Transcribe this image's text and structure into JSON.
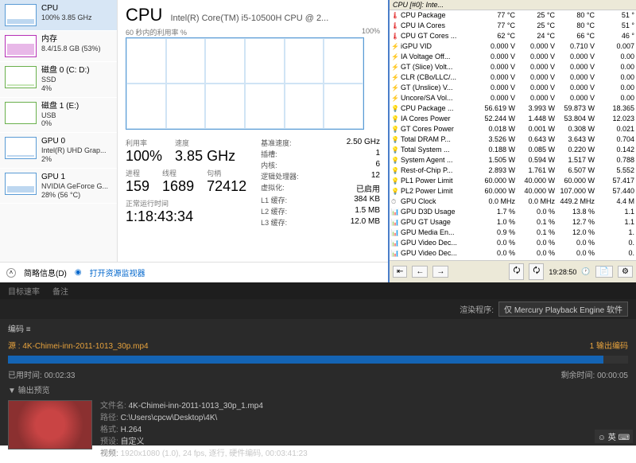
{
  "tm": {
    "sidebar": [
      {
        "title": "CPU",
        "sub": "100%  3.85 GHz"
      },
      {
        "title": "内存",
        "sub": "8.4/15.8 GB (53%)"
      },
      {
        "title": "磁盘 0 (C: D:)",
        "sub": "SSD\n4%"
      },
      {
        "title": "磁盘 1 (E:)",
        "sub": "USB\n0%"
      },
      {
        "title": "GPU 0",
        "sub": "Intel(R) UHD Grap...\n2%"
      },
      {
        "title": "GPU 1",
        "sub": "NVIDIA GeForce G...\n28% (56 °C)"
      }
    ],
    "title": "CPU",
    "subtitle": "Intel(R) Core(TM) i5-10500H CPU @ 2...",
    "graph_label_left": "60 秒内的利用率 %",
    "graph_label_right": "100%",
    "stats_left": {
      "util_lab": "利用率",
      "util": "100%",
      "spd_lab": "速度",
      "spd": "3.85 GHz",
      "proc_lab": "进程",
      "proc": "159",
      "thr_lab": "线程",
      "thr": "1689",
      "hnd_lab": "句柄",
      "hnd": "72412",
      "up_lab": "正常运行时间",
      "up": "1:18:43:34"
    },
    "stats_right": [
      {
        "k": "基准速度:",
        "v": "2.50 GHz"
      },
      {
        "k": "插槽:",
        "v": "1"
      },
      {
        "k": "内核:",
        "v": "6"
      },
      {
        "k": "逻辑处理器:",
        "v": "12"
      },
      {
        "k": "虚拟化:",
        "v": "已启用"
      },
      {
        "k": "L1 缓存:",
        "v": "384 KB"
      },
      {
        "k": "L2 缓存:",
        "v": "1.5 MB"
      },
      {
        "k": "L3 缓存:",
        "v": "12.0 MB"
      }
    ],
    "foot_brief": "简略信息(D)",
    "foot_link": "打开资源监视器"
  },
  "hw": {
    "header": "CPU [#0]: Inte...",
    "rows": [
      {
        "ic": "t",
        "n": "CPU Package",
        "a": "77 °C",
        "b": "25 °C",
        "c": "80 °C",
        "d": "51 °"
      },
      {
        "ic": "t",
        "n": "CPU IA Cores",
        "a": "77 °C",
        "b": "25 °C",
        "c": "80 °C",
        "d": "51 °"
      },
      {
        "ic": "t",
        "n": "CPU GT Cores ...",
        "a": "62 °C",
        "b": "24 °C",
        "c": "66 °C",
        "d": "46 °"
      },
      {
        "ic": "v",
        "n": "iGPU VID",
        "a": "0.000 V",
        "b": "0.000 V",
        "c": "0.710 V",
        "d": "0.007"
      },
      {
        "ic": "v",
        "n": "IA Voltage Off...",
        "a": "0.000 V",
        "b": "0.000 V",
        "c": "0.000 V",
        "d": "0.00"
      },
      {
        "ic": "v",
        "n": "GT (Slice) Volt...",
        "a": "0.000 V",
        "b": "0.000 V",
        "c": "0.000 V",
        "d": "0.00"
      },
      {
        "ic": "v",
        "n": "CLR (CBo/LLC/...",
        "a": "0.000 V",
        "b": "0.000 V",
        "c": "0.000 V",
        "d": "0.00"
      },
      {
        "ic": "v",
        "n": "GT (Unslice) V...",
        "a": "0.000 V",
        "b": "0.000 V",
        "c": "0.000 V",
        "d": "0.00"
      },
      {
        "ic": "v",
        "n": "Uncore/SA Vol...",
        "a": "0.000 V",
        "b": "0.000 V",
        "c": "0.000 V",
        "d": "0.00"
      },
      {
        "ic": "w",
        "n": "CPU Package ...",
        "a": "56.619 W",
        "b": "3.993 W",
        "c": "59.873 W",
        "d": "18.365"
      },
      {
        "ic": "w",
        "n": "IA Cores Power",
        "a": "52.244 W",
        "b": "1.448 W",
        "c": "53.804 W",
        "d": "12.023"
      },
      {
        "ic": "w",
        "n": "GT Cores Power",
        "a": "0.018 W",
        "b": "0.001 W",
        "c": "0.308 W",
        "d": "0.021"
      },
      {
        "ic": "w",
        "n": "Total DRAM P...",
        "a": "3.526 W",
        "b": "0.643 W",
        "c": "3.643 W",
        "d": "0.704"
      },
      {
        "ic": "w",
        "n": "Total System ...",
        "a": "0.188 W",
        "b": "0.085 W",
        "c": "0.220 W",
        "d": "0.142"
      },
      {
        "ic": "w",
        "n": "System Agent ...",
        "a": "1.505 W",
        "b": "0.594 W",
        "c": "1.517 W",
        "d": "0.788"
      },
      {
        "ic": "w",
        "n": "Rest-of-Chip P...",
        "a": "2.893 W",
        "b": "1.761 W",
        "c": "6.507 W",
        "d": "5.552"
      },
      {
        "ic": "w",
        "n": "PL1 Power Limit",
        "a": "60.000 W",
        "b": "40.000 W",
        "c": "60.000 W",
        "d": "57.417"
      },
      {
        "ic": "w",
        "n": "PL2 Power Limit",
        "a": "60.000 W",
        "b": "40.000 W",
        "c": "107.000 W",
        "d": "57.440"
      },
      {
        "ic": "c",
        "n": "GPU Clock",
        "a": "0.0 MHz",
        "b": "0.0 MHz",
        "c": "449.2 MHz",
        "d": "4.4 M"
      },
      {
        "ic": "u",
        "n": "GPU D3D Usage",
        "a": "1.7 %",
        "b": "0.0 %",
        "c": "13.8 %",
        "d": "1.1"
      },
      {
        "ic": "u",
        "n": "GPU GT Usage",
        "a": "1.0 %",
        "b": "0.1 %",
        "c": "12.7 %",
        "d": "1.1"
      },
      {
        "ic": "u",
        "n": "GPU Media En...",
        "a": "0.9 %",
        "b": "0.1 %",
        "c": "12.0 %",
        "d": "1."
      },
      {
        "ic": "u",
        "n": "GPU Video Dec...",
        "a": "0.0 %",
        "b": "0.0 %",
        "c": "0.0 %",
        "d": "0."
      },
      {
        "ic": "u",
        "n": "GPU Video Dec...",
        "a": "0.0 %",
        "b": "0.0 %",
        "c": "0.0 %",
        "d": "0."
      }
    ],
    "time": "19:28:50"
  },
  "ame": {
    "tabs": [
      "目标速率",
      "备注"
    ],
    "render_lab": "渲染程序:",
    "render_val": "仅 Mercury Playback Engine 软件",
    "encode": "编码 ≡",
    "src_lab": "源",
    "src_val": "4K-Chimei-inn-2011-1013_30p.mp4",
    "out_count": "1 输出编码",
    "elapsed_lab": "已用时间:",
    "elapsed": "00:02:33",
    "remain_lab": "剩余时间:",
    "remain": "00:00:05",
    "preview": "▼ 输出预览",
    "meta": {
      "file_k": "文件名:",
      "file_v": "4K-Chimei-inn-2011-1013_30p_1.mp4",
      "path_k": "路径:",
      "path_v": "C:\\Users\\cpcw\\Desktop\\4K\\",
      "fmt_k": "格式:",
      "fmt_v": "H.264",
      "preset_k": "预设:",
      "preset_v": "自定义",
      "vid_k": "视频:",
      "vid_v": "1920x1080 (1.0), 24 fps, 逐行, 硬件编码, 00:03:41:23"
    },
    "tray": "☺  英  ⌨"
  }
}
